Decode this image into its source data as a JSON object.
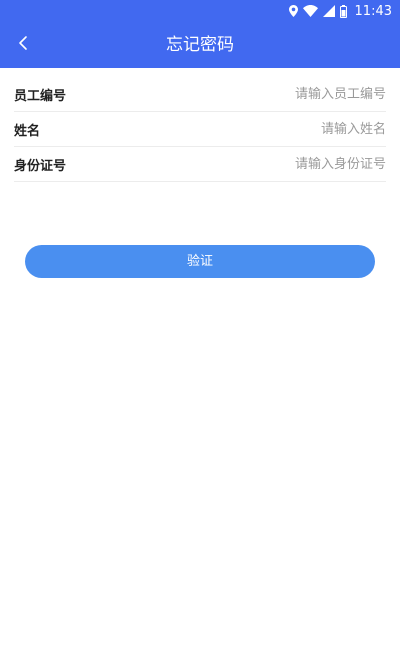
{
  "status_bar": {
    "time": "11:43",
    "icons": [
      "location-icon",
      "wifi-icon",
      "signal-icon",
      "battery-icon"
    ]
  },
  "header": {
    "title": "忘记密码",
    "back_icon": "chevron-left-icon"
  },
  "form": {
    "fields": [
      {
        "label": "员工编号",
        "placeholder": "请输入员工编号",
        "value": ""
      },
      {
        "label": "姓名",
        "placeholder": "请输入姓名",
        "value": ""
      },
      {
        "label": "身份证号",
        "placeholder": "请输入身份证号",
        "value": ""
      }
    ]
  },
  "actions": {
    "verify_label": "验证"
  },
  "colors": {
    "header_bg": "#4169f0",
    "button_bg": "#4a8ff0",
    "placeholder": "#9a9a9a"
  }
}
